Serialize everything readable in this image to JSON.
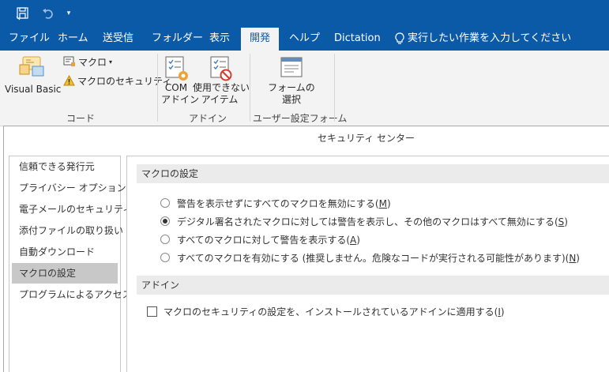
{
  "qat": {
    "save_icon": "save-icon",
    "undo_icon": "undo-icon",
    "customize_icon": "chevron-down-icon"
  },
  "tabs": [
    {
      "label": "ファイル"
    },
    {
      "label": "ホーム"
    },
    {
      "label": "送受信"
    },
    {
      "label": "フォルダー"
    },
    {
      "label": "表示"
    },
    {
      "label": "開発"
    },
    {
      "label": "ヘルプ"
    },
    {
      "label": "Dictation"
    },
    {
      "label": "実行したい作業を入力してください"
    }
  ],
  "ribbon": {
    "visual_basic": "Visual Basic",
    "macro": "マクロ",
    "macro_security": "マクロのセキュリティ",
    "code_group": "コード",
    "com_addin": "COM\nアドイン",
    "com_addin_l1": "COM",
    "com_addin_l2": "アドイン",
    "disabled_items_l1": "使用できない",
    "disabled_items_l2": "アイテム",
    "addin_group": "アドイン",
    "form_select_l1": "フォームの",
    "form_select_l2": "選択",
    "user_form_group": "ユーザー設定フォーム"
  },
  "dialog": {
    "title": "セキュリティ センター",
    "sidebar": [
      {
        "label": "信頼できる発行元"
      },
      {
        "label": "プライバシー オプション"
      },
      {
        "label": "電子メールのセキュリティ"
      },
      {
        "label": "添付ファイルの取り扱い"
      },
      {
        "label": "自動ダウンロード"
      },
      {
        "label": "マクロの設定"
      },
      {
        "label": "プログラムによるアクセス"
      }
    ],
    "macro_section": "マクロの設定",
    "options": [
      {
        "text": "警告を表示せずにすべてのマクロを無効にする(",
        "key": "M",
        "tail": ")"
      },
      {
        "text": "デジタル署名されたマクロに対しては警告を表示し、その他のマクロはすべて無効にする(",
        "key": "S",
        "tail": ")"
      },
      {
        "text": "すべてのマクロに対して警告を表示する(",
        "key": "A",
        "tail": ")"
      },
      {
        "text": "すべてのマクロを有効にする (推奨しません。危険なコードが実行される可能性があります)(",
        "key": "N",
        "tail": ")"
      }
    ],
    "selected_option": 1,
    "addin_section": "アドイン",
    "addin_checkbox": {
      "text": "マクロのセキュリティの設定を、インストールされているアドインに適用する(",
      "key": "I",
      "tail": ")",
      "checked": false
    }
  }
}
